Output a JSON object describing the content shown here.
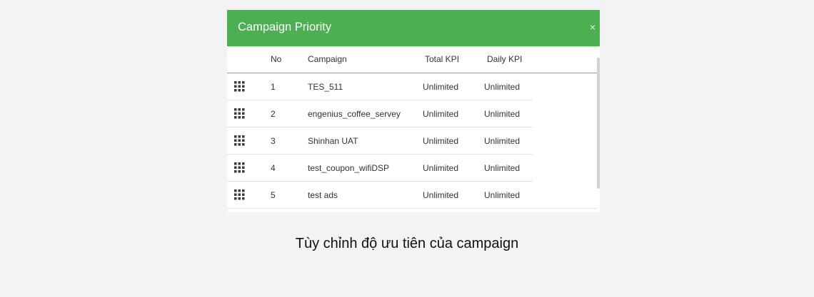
{
  "modal": {
    "title": "Campaign Priority",
    "close_label": "×",
    "header_color": "#4caf50"
  },
  "table": {
    "columns": {
      "no": "No",
      "campaign": "Campaign",
      "total_kpi": "Total KPI",
      "daily_kpi": "Daily KPI"
    },
    "rows": [
      {
        "no": "1",
        "campaign": "TES_511",
        "total_kpi": "Unlimited",
        "daily_kpi": "Unlimited",
        "handle_icon": "drag-grid-icon"
      },
      {
        "no": "2",
        "campaign": "engenius_coffee_servey",
        "total_kpi": "Unlimited",
        "daily_kpi": "Unlimited",
        "handle_icon": "drag-grid-icon"
      },
      {
        "no": "3",
        "campaign": "Shinhan UAT",
        "total_kpi": "Unlimited",
        "daily_kpi": "Unlimited",
        "handle_icon": "drag-grid-icon"
      },
      {
        "no": "4",
        "campaign": "test_coupon_wifiDSP",
        "total_kpi": "Unlimited",
        "daily_kpi": "Unlimited",
        "handle_icon": "drag-grid-icon"
      },
      {
        "no": "5",
        "campaign": "test ads",
        "total_kpi": "Unlimited",
        "daily_kpi": "Unlimited",
        "handle_icon": "drag-grid-icon"
      }
    ]
  },
  "caption": "Tùy chỉnh độ ưu tiên của campaign"
}
